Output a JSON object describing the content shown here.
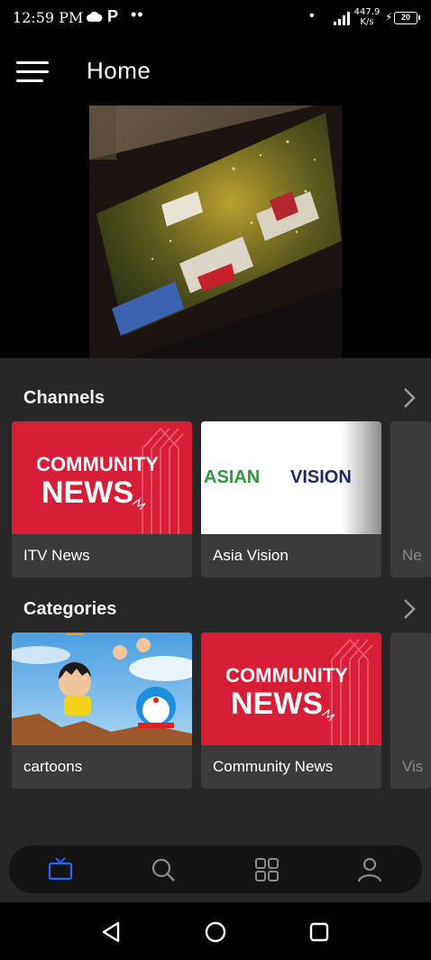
{
  "status_bar": {
    "time": "12:59 PM",
    "carrier_glyph": "P",
    "dots": "••",
    "indicator_dot": "•",
    "net_speed_value": "447.9",
    "net_speed_unit": "K/s",
    "battery_level": "20"
  },
  "header": {
    "title": "Home",
    "menu_icon": "hamburger-menu-icon"
  },
  "hero": {
    "image": "event-stage-screen-photo"
  },
  "channels": {
    "title": "Channels",
    "items": [
      {
        "label": "ITV News",
        "logo_line1": "COMMUNITY",
        "logo_line2": "NEWS"
      },
      {
        "label": "Asia Vision",
        "logo_word1": "ASIAN",
        "logo_word2": "VISION"
      },
      {
        "label": "Ne"
      }
    ]
  },
  "categories": {
    "title": "Categories",
    "items": [
      {
        "label": "cartoons"
      },
      {
        "label": "Community News",
        "logo_line1": "COMMUNITY",
        "logo_line2": "NEWS"
      },
      {
        "label": "Vis"
      }
    ]
  },
  "bottom_nav": {
    "items": [
      "tv-icon",
      "search-icon",
      "grid-icon",
      "profile-icon"
    ],
    "active_color": "#2962ff",
    "inactive_color": "#8a8a8a"
  },
  "system_nav": [
    "back-icon",
    "home-icon",
    "recents-icon"
  ],
  "colors": {
    "news_red": "#d81e37",
    "asian_green": "#2f9a3c",
    "vision_navy": "#1e2a66",
    "sheet_bg": "#272727"
  }
}
